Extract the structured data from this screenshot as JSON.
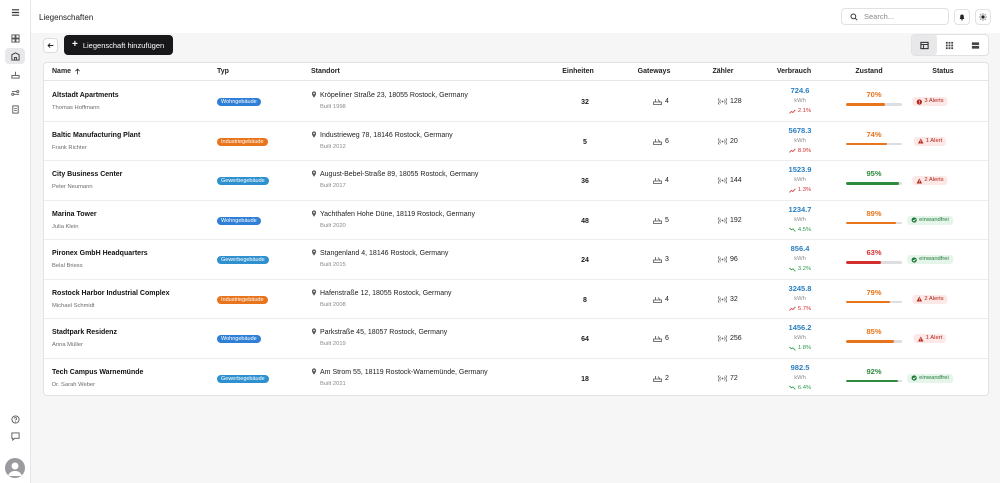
{
  "header": {
    "title": "Liegenschaften",
    "search_placeholder": "Search..."
  },
  "toolbar": {
    "add_label": "Liegenschaft hinzufügen"
  },
  "columns": [
    "Name",
    "Typ",
    "Standort",
    "Einheiten",
    "Gateways",
    "Zähler",
    "Verbrauch",
    "Zustand",
    "Status"
  ],
  "sort": {
    "column": "Name",
    "direction": "asc"
  },
  "colors": {
    "accent": "#18181b",
    "wohngebaeude": "#2f7fd6",
    "industriegebaeude": "#e8741c",
    "gewerbegebaeude": "#2f90d0",
    "alert_bg": "#fde8e8",
    "ok_bg": "#e6f5ea",
    "consumption": "#2a7fc1"
  },
  "rows": [
    {
      "name": "Altstadt Apartments",
      "owner": "Thomas Hoffmann",
      "type": "Wohngebäude",
      "type_color": "#2f7fd6",
      "address": "Kröpeliner Straße 23, 18055 Rostock, Germany",
      "built": "Built 1998",
      "units": "32",
      "gateways": "4",
      "meters": "128",
      "consumption": "724.6",
      "unit": "kWh",
      "trend": "2.1%",
      "trend_dir": "up",
      "condition": "70%",
      "condition_value": 70,
      "condition_color": "#e8741c",
      "status": "3 Alerts",
      "status_type": "alert"
    },
    {
      "name": "Baltic Manufacturing Plant",
      "owner": "Frank Richter",
      "type": "Industriegebäude",
      "type_color": "#e8741c",
      "address": "Industrieweg 78, 18146 Rostock, Germany",
      "built": "Built 2012",
      "units": "5",
      "gateways": "6",
      "meters": "20",
      "consumption": "5678.3",
      "unit": "kWh",
      "trend": "8.9%",
      "trend_dir": "up",
      "condition": "74%",
      "condition_value": 74,
      "condition_color": "#e8741c",
      "status": "1 Alert",
      "status_type": "alert"
    },
    {
      "name": "City Business Center",
      "owner": "Peter Neumann",
      "type": "Gewerbegebäude",
      "type_color": "#2f90d0",
      "address": "August-Bebel-Straße 89, 18055 Rostock, Germany",
      "built": "Built 2017",
      "units": "36",
      "gateways": "4",
      "meters": "144",
      "consumption": "1523.9",
      "unit": "kWh",
      "trend": "1.3%",
      "trend_dir": "up",
      "condition": "95%",
      "condition_value": 95,
      "condition_color": "#2e8b3e",
      "status": "2 Alerts",
      "status_type": "alert"
    },
    {
      "name": "Marina Tower",
      "owner": "Julia Klein",
      "type": "Wohngebäude",
      "type_color": "#2f7fd6",
      "address": "Yachthafen Hohe Düne, 18119 Rostock, Germany",
      "built": "Built 2020",
      "units": "48",
      "gateways": "5",
      "meters": "192",
      "consumption": "1234.7",
      "unit": "kWh",
      "trend": "4.5%",
      "trend_dir": "down",
      "condition": "89%",
      "condition_value": 89,
      "condition_color": "#e8741c",
      "status": "einwandfrei",
      "status_type": "ok"
    },
    {
      "name": "Pironex GmbH Headquarters",
      "owner": "Belal Briess",
      "type": "Gewerbegebäude",
      "type_color": "#2f90d0",
      "address": "Stangenland 4, 18146 Rostock, Germany",
      "built": "Built 2015",
      "units": "24",
      "gateways": "3",
      "meters": "96",
      "consumption": "856.4",
      "unit": "kWh",
      "trend": "3.2%",
      "trend_dir": "down",
      "condition": "63%",
      "condition_value": 63,
      "condition_color": "#d32f2f",
      "status": "einwandfrei",
      "status_type": "ok"
    },
    {
      "name": "Rostock Harbor Industrial Complex",
      "owner": "Michael Schmidt",
      "type": "Industriegebäude",
      "type_color": "#e8741c",
      "address": "Hafenstraße 12, 18055 Rostock, Germany",
      "built": "Built 2008",
      "units": "8",
      "gateways": "4",
      "meters": "32",
      "consumption": "3245.8",
      "unit": "kWh",
      "trend": "5.7%",
      "trend_dir": "up",
      "condition": "79%",
      "condition_value": 79,
      "condition_color": "#e8741c",
      "status": "2 Alerts",
      "status_type": "alert"
    },
    {
      "name": "Stadtpark Residenz",
      "owner": "Anna Müller",
      "type": "Wohngebäude",
      "type_color": "#2f7fd6",
      "address": "Parkstraße 45, 18057 Rostock, Germany",
      "built": "Built 2019",
      "units": "64",
      "gateways": "6",
      "meters": "256",
      "consumption": "1456.2",
      "unit": "kWh",
      "trend": "1.8%",
      "trend_dir": "down",
      "condition": "85%",
      "condition_value": 85,
      "condition_color": "#e8741c",
      "status": "1 Alert",
      "status_type": "alert"
    },
    {
      "name": "Tech Campus Warnemünde",
      "owner": "Dr. Sarah Weber",
      "type": "Gewerbegebäude",
      "type_color": "#2f90d0",
      "address": "Am Strom 55, 18119 Rostock-Warnemünde, Germany",
      "built": "Built 2021",
      "units": "18",
      "gateways": "2",
      "meters": "72",
      "consumption": "982.5",
      "unit": "kWh",
      "trend": "6.4%",
      "trend_dir": "down",
      "condition": "92%",
      "condition_value": 92,
      "condition_color": "#2e8b3e",
      "status": "einwandfrei",
      "status_type": "ok"
    }
  ],
  "icons": {
    "sidebar": [
      "menu-icon",
      "dashboard-icon",
      "buildings-icon",
      "gateway-icon",
      "meter-icon",
      "document-icon",
      "help-icon",
      "feedback-icon"
    ],
    "header": [
      "search-icon",
      "bell-icon",
      "sun-icon"
    ],
    "view": [
      "table-view-icon",
      "grid-view-icon",
      "list-view-icon"
    ]
  }
}
